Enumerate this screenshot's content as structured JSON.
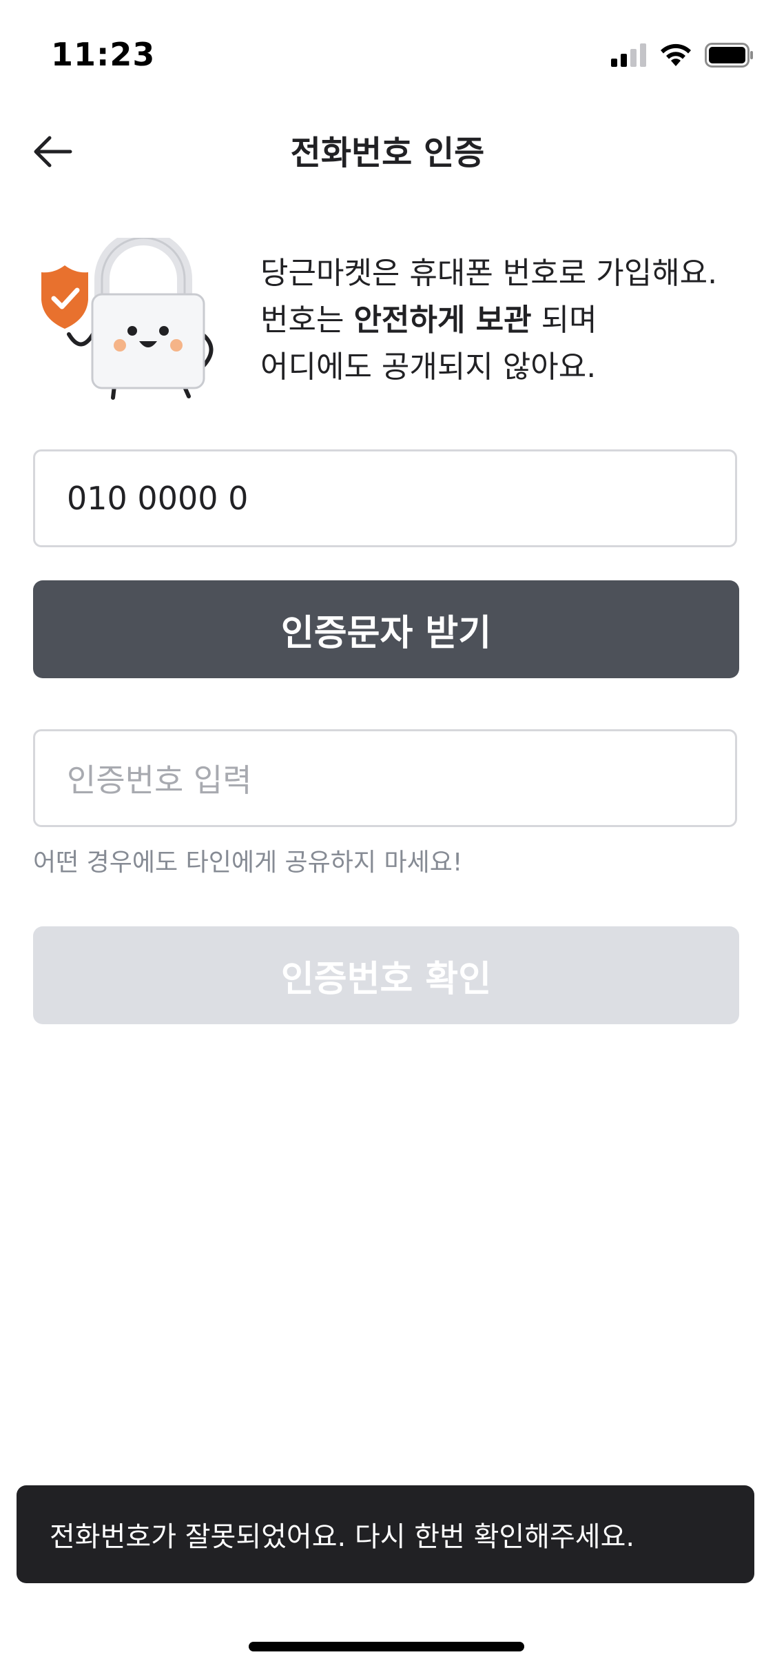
{
  "status_bar": {
    "time": "11:23",
    "icons": [
      "cellular-signal-icon",
      "wifi-icon",
      "battery-icon"
    ]
  },
  "nav": {
    "back_icon": "arrow-left-icon",
    "title": "전화번호 인증"
  },
  "intro": {
    "line1": "당근마켓은 휴대폰 번호로 가입해요.",
    "line2_prefix": "번호는 ",
    "line2_bold": "안전하게 보관",
    "line2_suffix": " 되며",
    "line3": "어디에도 공개되지 않아요."
  },
  "form": {
    "phone_value": "010 0000 0",
    "send_button_label": "인증문자 받기",
    "code_placeholder": "인증번호 입력",
    "hint": "어떤 경우에도 타인에게 공유하지 마세요!",
    "confirm_button_label": "인증번호 확인"
  },
  "toast": {
    "message": "전화번호가 잘못되었어요. 다시 한번 확인해주세요."
  },
  "colors": {
    "primary_dark": "#4d5159",
    "disabled": "#dcdee3",
    "toast_bg": "#212124",
    "shield": "#e8712e"
  }
}
